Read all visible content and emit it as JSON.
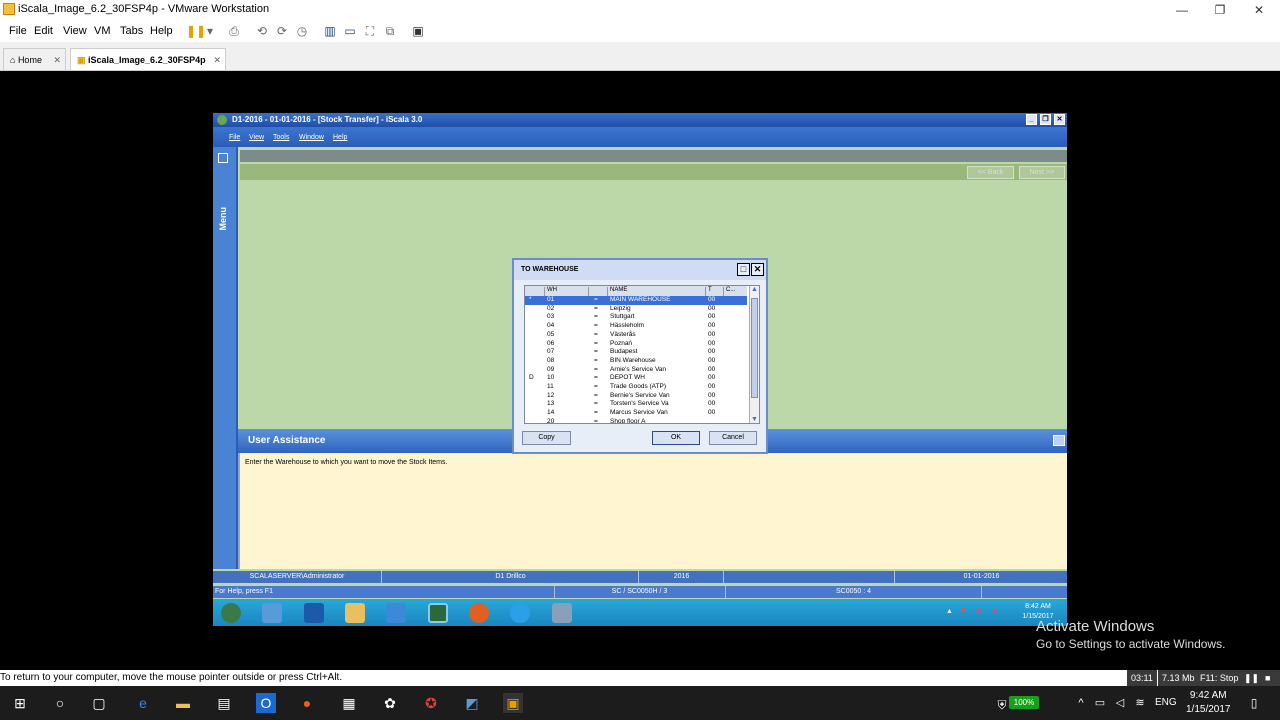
{
  "vmware": {
    "title": "iScala_Image_6.2_30FSP4p - VMware Workstation",
    "menu": [
      "File",
      "Edit",
      "View",
      "VM",
      "Tabs",
      "Help"
    ],
    "tabs": [
      {
        "label": "Home"
      },
      {
        "label": "iScala_Image_6.2_30FSP4p"
      }
    ],
    "status_message": "To return to your computer, move the mouse pointer outside or press Ctrl+Alt.",
    "recording": {
      "time": "03:11",
      "size": "7.13 Mb",
      "stop": "F11: Stop"
    }
  },
  "iscala": {
    "title": "D1-2016 - 01-01-2016 - [Stock Transfer] - iScala 3.0",
    "menu": [
      "File",
      "View",
      "Tools",
      "Window",
      "Help"
    ],
    "side_label": "Menu",
    "nav": {
      "back": "<< Back",
      "next": "Next >>"
    },
    "user_assistance": {
      "title": "User Assistance",
      "text": "Enter the Warehouse to which you want to move the Stock Items."
    },
    "status": {
      "user": "SCALASERVER\\Administrator",
      "company": "D1 Drillco",
      "year": "2016",
      "date": "01-01-2016",
      "help": "For Help, press F1",
      "module": "SC / SC0050H / 3",
      "form": "SC0050 : 4"
    },
    "tray": {
      "time": "8:42 AM",
      "date": "1/15/2017"
    }
  },
  "dialog": {
    "title": "TO WAREHOUSE",
    "columns": {
      "wh": "WH",
      "name": "NAME",
      "t": "T",
      "c": "C..."
    },
    "rows": [
      {
        "flag": "*",
        "wh": "01",
        "eq": "=",
        "name": "MAIN WAREHOUSE",
        "t": "00"
      },
      {
        "flag": "",
        "wh": "02",
        "eq": "=",
        "name": "Leipzig",
        "t": "00"
      },
      {
        "flag": "",
        "wh": "03",
        "eq": "=",
        "name": "Stuttgart",
        "t": "00"
      },
      {
        "flag": "",
        "wh": "04",
        "eq": "=",
        "name": "Hässleholm",
        "t": "00"
      },
      {
        "flag": "",
        "wh": "05",
        "eq": "=",
        "name": "Västerås",
        "t": "00"
      },
      {
        "flag": "",
        "wh": "06",
        "eq": "=",
        "name": "Poznań",
        "t": "00"
      },
      {
        "flag": "",
        "wh": "07",
        "eq": "=",
        "name": "Budapest",
        "t": "00"
      },
      {
        "flag": "",
        "wh": "08",
        "eq": "=",
        "name": "BIN Warehouse",
        "t": "00"
      },
      {
        "flag": "",
        "wh": "09",
        "eq": "=",
        "name": "Arnie's Service Van",
        "t": "00"
      },
      {
        "flag": "D",
        "wh": "10",
        "eq": "=",
        "name": "DEPOT WH",
        "t": "00"
      },
      {
        "flag": "",
        "wh": "11",
        "eq": "=",
        "name": "Trade Goods (ATP)",
        "t": "00"
      },
      {
        "flag": "",
        "wh": "12",
        "eq": "=",
        "name": "Bernie's Service Van",
        "t": "00"
      },
      {
        "flag": "",
        "wh": "13",
        "eq": "=",
        "name": "Torsten's Service Va",
        "t": "00"
      },
      {
        "flag": "",
        "wh": "14",
        "eq": "=",
        "name": "Marcus Service Van",
        "t": "00"
      },
      {
        "flag": "",
        "wh": "20",
        "eq": "=",
        "name": "Shop floor A",
        "t": ""
      }
    ],
    "buttons": {
      "copy": "Copy",
      "ok": "OK",
      "cancel": "Cancel"
    }
  },
  "watermark": {
    "line1": "Activate Windows",
    "line2": "Go to Settings to activate Windows."
  },
  "windows": {
    "battery": "100%",
    "language": "ENG",
    "time": "9:42 AM",
    "date": "1/15/2017"
  }
}
